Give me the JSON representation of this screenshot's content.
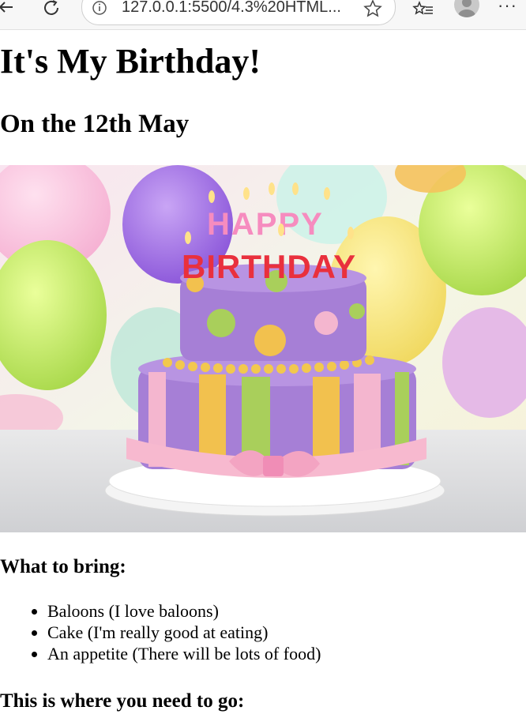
{
  "browser": {
    "url": "127.0.0.1:5500/4.3%20HTML..."
  },
  "page": {
    "title": "It's My Birthday!",
    "subtitle": "On the 12th May",
    "cake_text_top": "HAPPY",
    "cake_text_bottom": "BIRTHDAY",
    "bring_heading": "What to bring:",
    "bring_items": [
      "Baloons (I love baloons)",
      "Cake (I'm really good at eating)",
      "An appetite (There will be lots of food)"
    ],
    "directions_heading": "This is where you need to go:"
  },
  "colors": {
    "cake_purple": "#a67fd6",
    "cake_pink": "#f4b6cf",
    "cake_yellow": "#f2c14e",
    "cake_green": "#a9cf5b"
  }
}
